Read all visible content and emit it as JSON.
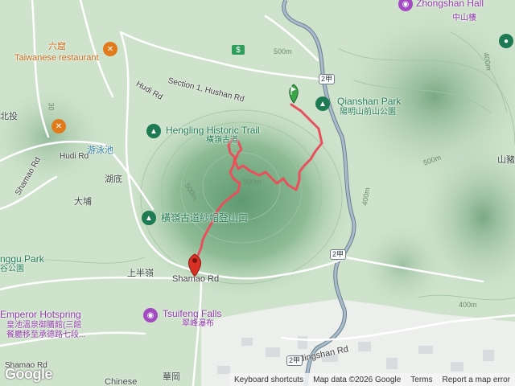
{
  "labels": {
    "zhongshan_hall": "Zhongshan Hall",
    "zhongshan_hall_zh": "中山樓",
    "liu_ku": "六窟",
    "taiwanese_restaurant": "Taiwanese restaurant",
    "section1_hushan_rd": "Section 1, Hushan Rd",
    "hudi_rd_1": "Hudi Rd",
    "hudi_rd_2": "Hudi Rd",
    "qianshan_park": "Qianshan Park",
    "qianshan_park_zh": "陽明山前山公園",
    "hengling_trail": "Hengling Historic Trail",
    "hengling_trail_zh": "橫嶺古道",
    "hengling_trailhead_zh": "橫嶺古道紗帽登山口",
    "swimming_pool_zh": "游泳池",
    "hudi_zh": "湖底",
    "dapu_zh": "大埔",
    "shamao_rd_1": "Shamao Rd",
    "shamao_rd_2": "Shamao Rd",
    "shamao_rd_3": "Shamao Rd",
    "shangbanling_zh": "上半嶺",
    "beitou_zh": "北投",
    "shan_zh": "山豬",
    "nggu_park": "nggu Park",
    "nggu_park_zh": "谷公園",
    "emperor_hotspring": "Emperor Hotspring",
    "emperor_hotspring_zh1": "皇池溫泉御膳館(三館",
    "emperor_hotspring_zh2": "餐廳移至承德路七段...",
    "tsuifeng_falls": "Tsuifeng Falls",
    "tsuifeng_falls_zh": "翠峰瀑布",
    "jingshan_rd": "Jingshan Rd",
    "huagang_zh": "華岡",
    "chinese": "Chinese",
    "contour_500_a": "500m",
    "contour_500_b": "500m",
    "contour_500_c": "500m",
    "contour_500_d": "500m",
    "contour_400_a": "400m",
    "contour_400_b": "400m",
    "contour_400_c": "400m",
    "contour_300": "30"
  },
  "shields": {
    "s1": "2甲",
    "s2": "2甲",
    "s3": "2甲"
  },
  "attribution": {
    "google": "Google",
    "keyboard_shortcuts": "Keyboard shortcuts",
    "map_data": "Map data ©2026 Google",
    "terms": "Terms",
    "report": "Report a map error"
  },
  "colors": {
    "route": "#e8505b",
    "land": "#cfe3cc",
    "urban": "#eef0ee",
    "road": "#ffffff",
    "highway": "#8aa2b8",
    "river": "#6b7f8f",
    "poi_green": "#1e7a52",
    "poi_orange": "#e07b1c",
    "poi_purple": "#a24bc0"
  },
  "icons": {
    "start_marker": "green-flag-pin-icon",
    "end_marker": "red-location-pin-icon",
    "park": "tree-icon",
    "restaurant": "fork-knife-icon",
    "attraction": "camera-icon"
  }
}
